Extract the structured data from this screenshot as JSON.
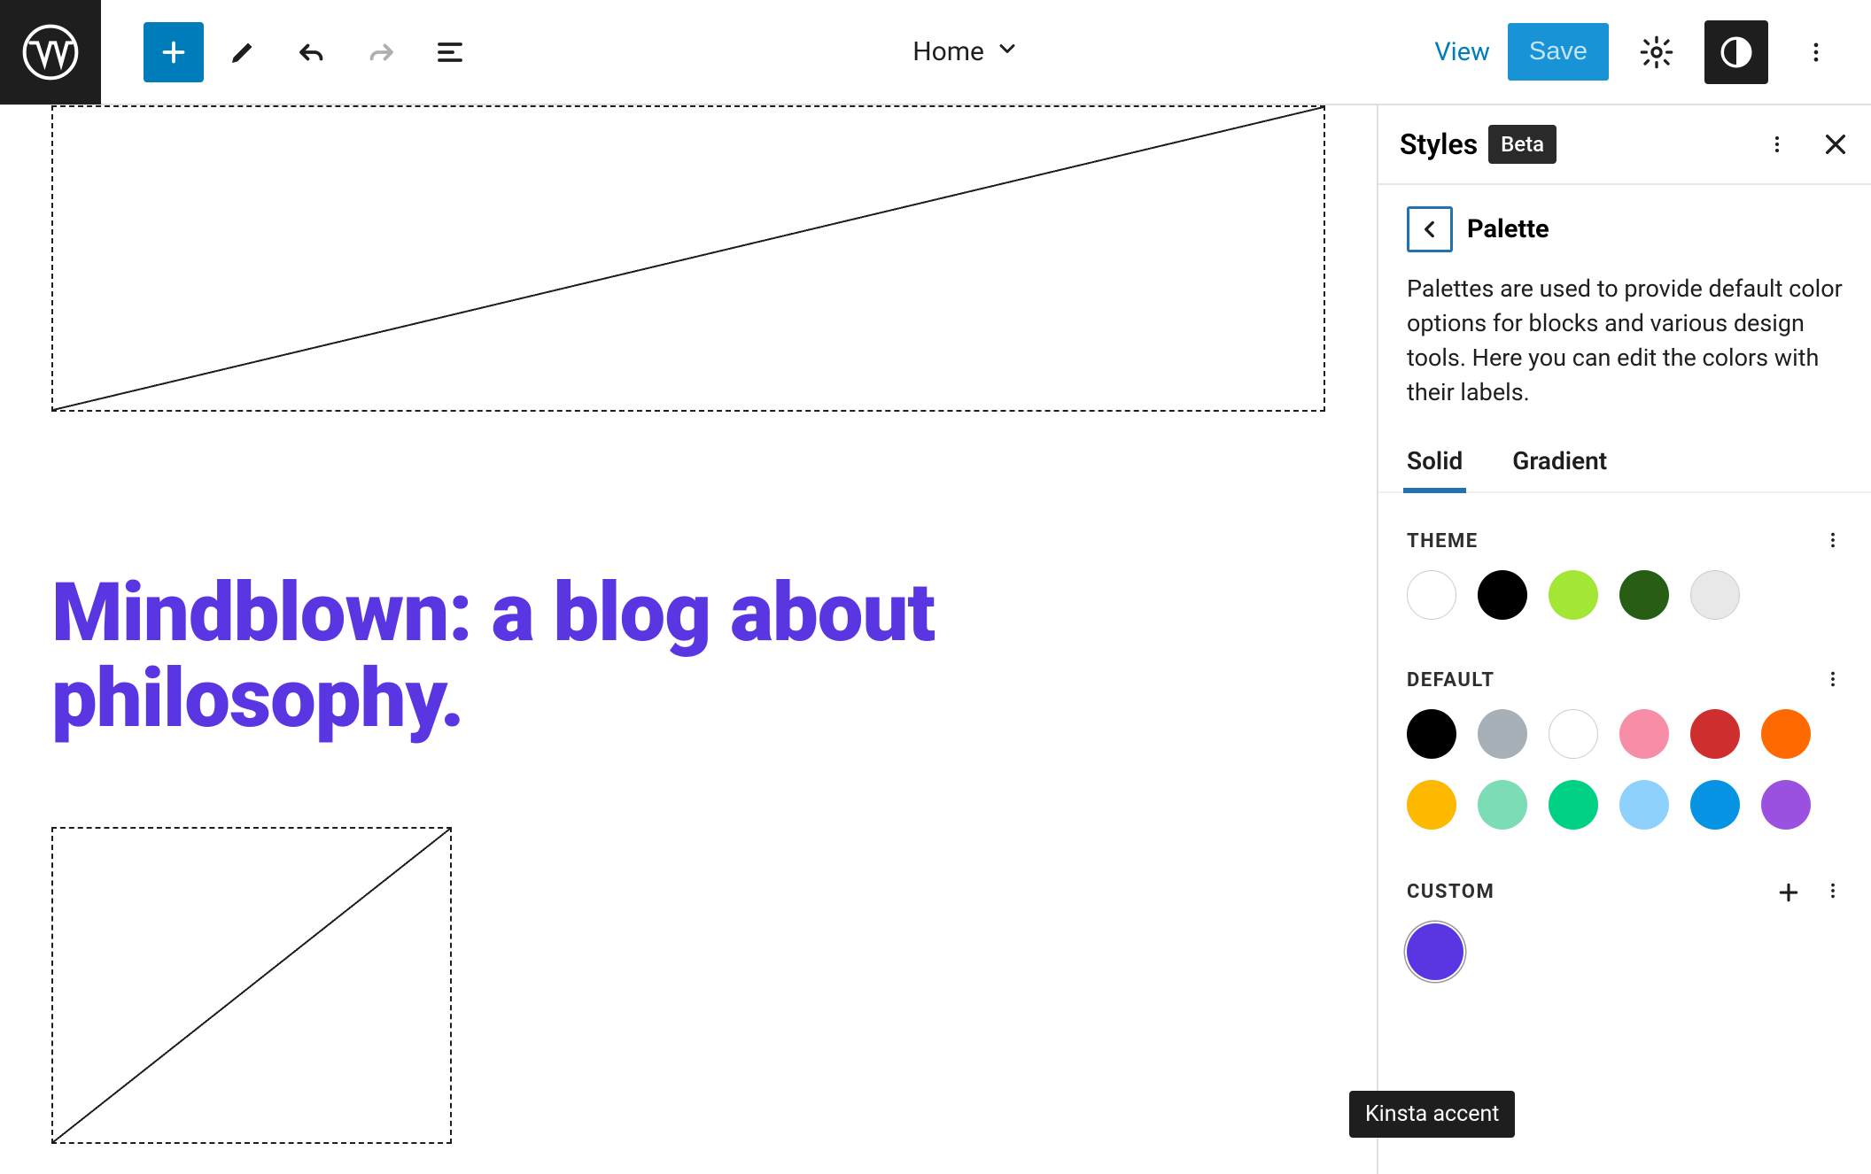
{
  "topbar": {
    "doc_title": "Home",
    "view_label": "View",
    "save_label": "Save"
  },
  "sidebar": {
    "title": "Styles",
    "badge": "Beta",
    "panel_title": "Palette",
    "description": "Palettes are used to provide default color options for blocks and various design tools. Here you can edit the colors with their labels.",
    "tabs": {
      "solid": "Solid",
      "gradient": "Gradient"
    },
    "sections": {
      "theme": "THEME",
      "default": "DEFAULT",
      "custom": "CUSTOM"
    },
    "theme_colors": [
      "#ffffff",
      "#000000",
      "#a3e635",
      "#285d14",
      "#e8e8e8"
    ],
    "theme_bordered": [
      true,
      false,
      false,
      false,
      true
    ],
    "default_colors": [
      "#000000",
      "#a7b0b6",
      "#ffffff",
      "#f78da7",
      "#cf2e2e",
      "#ff6900",
      "#fcb900",
      "#7bdcb5",
      "#00d084",
      "#8ed1fc",
      "#0693e3",
      "#9b51e0"
    ],
    "default_bordered": [
      false,
      false,
      true,
      false,
      false,
      false,
      false,
      false,
      false,
      false,
      false,
      false
    ],
    "custom_colors": [
      "#5a36e3"
    ],
    "tooltip": "Kinsta accent"
  },
  "canvas": {
    "heading": "Mindblown: a blog about philosophy."
  }
}
